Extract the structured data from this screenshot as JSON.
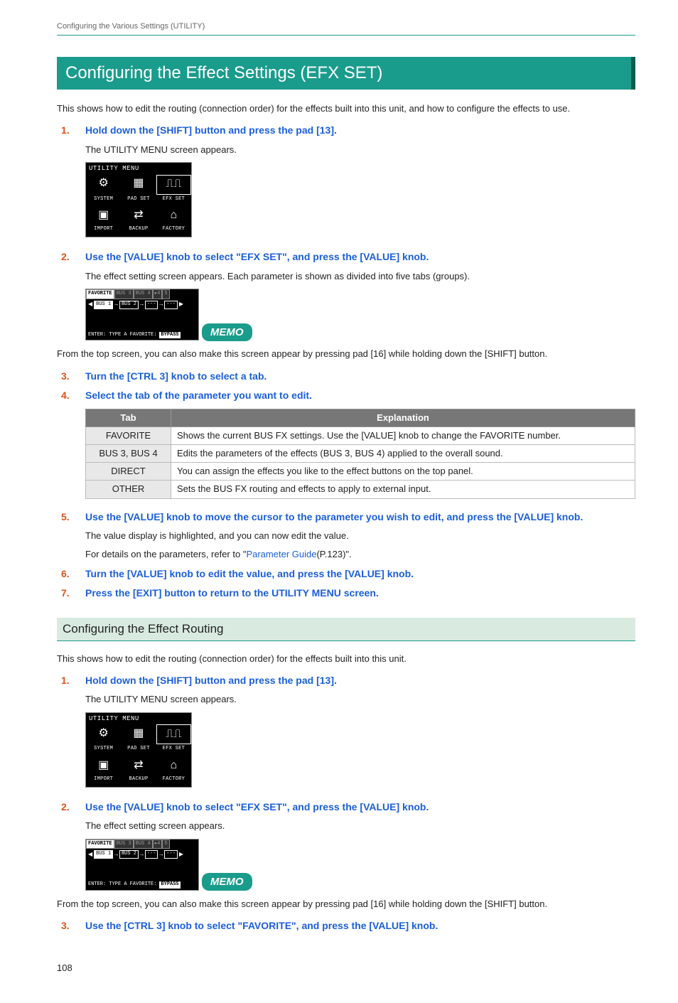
{
  "header_path": "Configuring the Various Settings (UTILITY)",
  "main_heading": "Configuring the Effect Settings (EFX SET)",
  "intro_text": "This shows how to edit the routing (connection order) for the effects built into this unit, and how to configure the effects to use.",
  "step1_num": "1.",
  "step1_text": "Hold down the [SHIFT] button and press the pad [13].",
  "step1_sub": "The UTILITY MENU screen appears.",
  "utility_menu": {
    "title": "UTILITY MENU",
    "row1": [
      "SYSTEM",
      "PAD SET",
      "EFX SET"
    ],
    "row2": [
      "IMPORT",
      "BACKUP",
      "FACTORY"
    ]
  },
  "step2_num": "2.",
  "step2_text": "Use the [VALUE] knob to select \"EFX SET\", and press the [VALUE] knob.",
  "step2_sub": "The effect setting screen appears. Each parameter is shown as divided into five tabs (groups).",
  "efx_screen": {
    "tabs": [
      "FAVORITE",
      "BUS 3",
      "BUS 4",
      "▸4",
      "5"
    ],
    "buses": [
      "BUS 1",
      "BUS 2",
      "---",
      "---"
    ],
    "footer_left": "ENTER: TYPE A",
    "footer_mid": "FAVORITE:",
    "footer_right": "BYPASS"
  },
  "memo_label": "MEMO",
  "memo1_text": "From the top screen, you can also make this screen appear by pressing pad [16] while holding down the [SHIFT] button.",
  "step3_num": "3.",
  "step3_text": "Turn the [CTRL 3] knob to select a tab.",
  "step4_num": "4.",
  "step4_text": "Select the tab of the parameter you want to edit.",
  "table": {
    "head_tab": "Tab",
    "head_exp": "Explanation",
    "rows": [
      {
        "tab": "FAVORITE",
        "exp": "Shows the current BUS FX settings. Use the [VALUE] knob to change the FAVORITE number."
      },
      {
        "tab": "BUS 3, BUS 4",
        "exp": "Edits the parameters of the effects (BUS 3, BUS 4) applied to the overall sound."
      },
      {
        "tab": "DIRECT",
        "exp": "You can assign the effects you like to the effect buttons on the top panel."
      },
      {
        "tab": "OTHER",
        "exp": "Sets the BUS FX routing and effects to apply to external input."
      }
    ]
  },
  "step5_num": "5.",
  "step5_text": "Use the [VALUE] knob to move the cursor to the parameter you wish to edit, and press the [VALUE] knob.",
  "step5_sub1": "The value display is highlighted, and you can now edit the value.",
  "step5_sub2a": "For details on the parameters, refer to \"",
  "step5_link": "Parameter Guide",
  "step5_sub2b": "(P.123)\".",
  "step6_num": "6.",
  "step6_text": "Turn the [VALUE] knob to edit the value, and press the [VALUE] knob.",
  "step7_num": "7.",
  "step7_text": "Press the [EXIT] button to return to the UTILITY MENU screen.",
  "sub_heading": "Configuring the Effect Routing",
  "sec2_intro": "This shows how to edit the routing (connection order) for the effects built into this unit.",
  "sec2_step1_num": "1.",
  "sec2_step1_text": "Hold down the [SHIFT] button and press the pad [13].",
  "sec2_step1_sub": "The UTILITY MENU screen appears.",
  "sec2_step2_num": "2.",
  "sec2_step2_text": "Use the [VALUE] knob to select \"EFX SET\", and press the [VALUE] knob.",
  "sec2_step2_sub": "The effect setting screen appears.",
  "memo2_text": "From the top screen, you can also make this screen appear by pressing pad [16] while holding down the [SHIFT] button.",
  "sec2_step3_num": "3.",
  "sec2_step3_text": "Use the [CTRL 3] knob to select \"FAVORITE\", and press the [VALUE] knob.",
  "page_num": "108"
}
